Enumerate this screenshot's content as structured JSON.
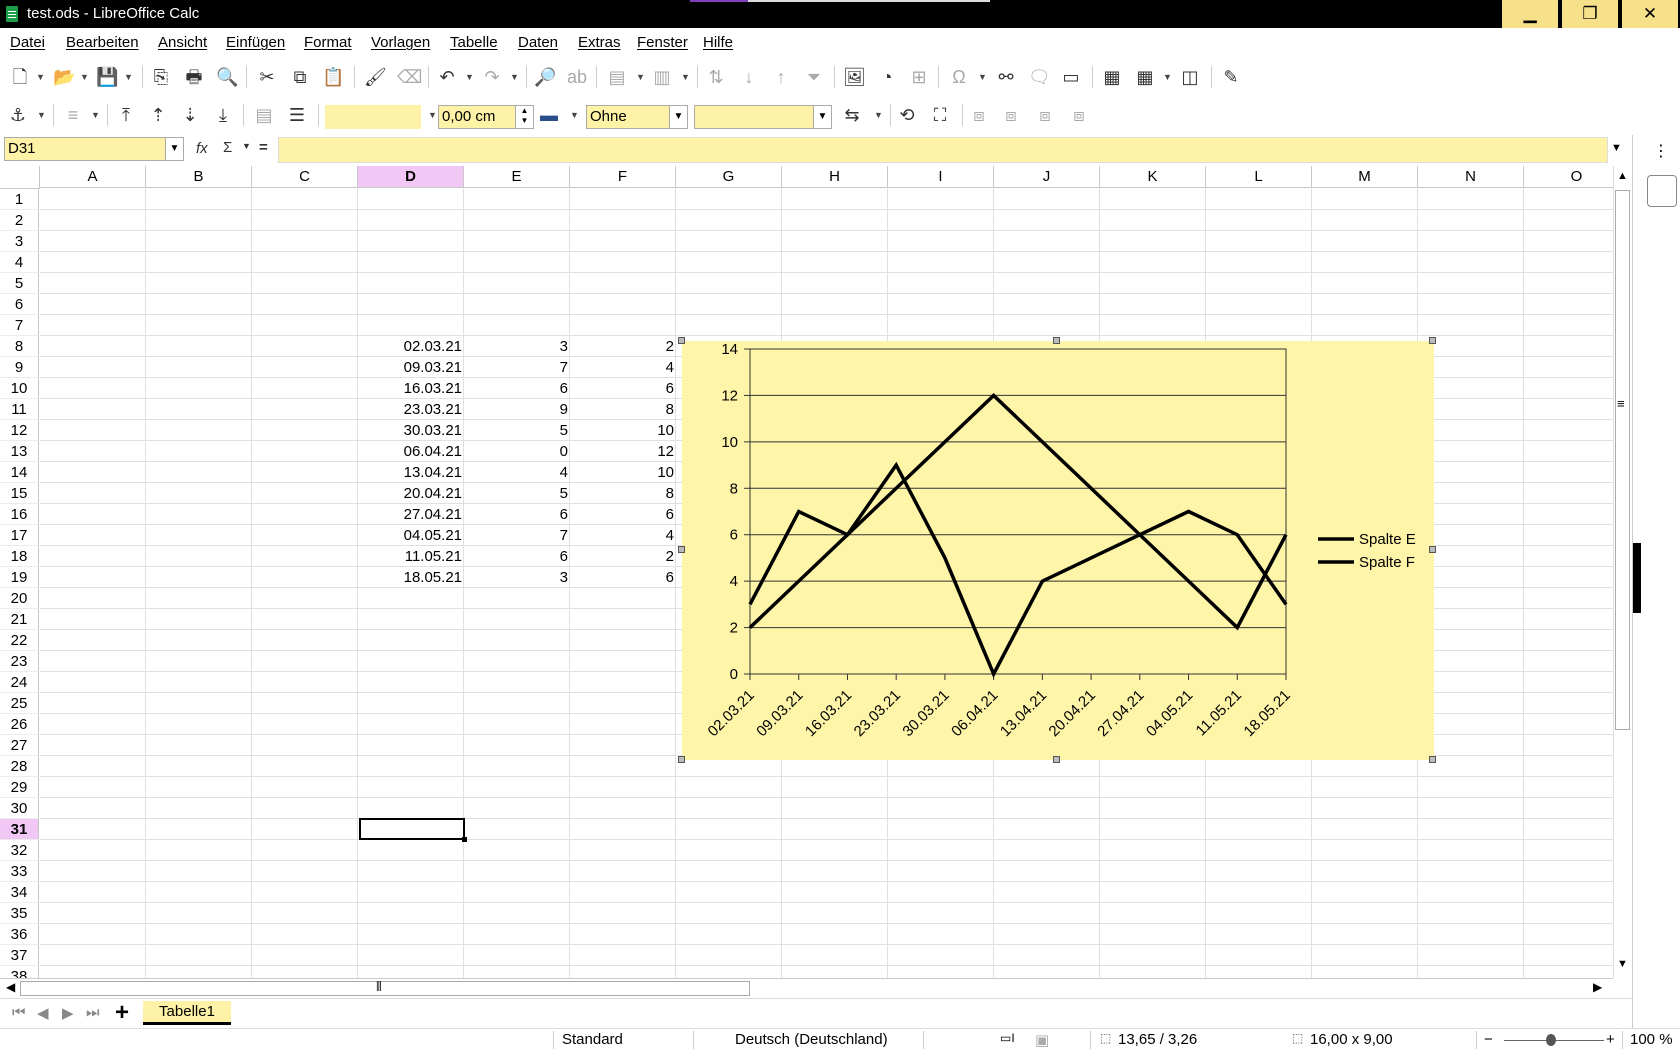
{
  "window": {
    "title": "test.ods - LibreOffice Calc",
    "minimize": "▁",
    "maximize": "❐",
    "close": "✕"
  },
  "menu": [
    "Datei",
    "Bearbeiten",
    "Ansicht",
    "Einfügen",
    "Format",
    "Vorlagen",
    "Tabelle",
    "Daten",
    "Extras",
    "Fenster",
    "Hilfe"
  ],
  "toolbar2": {
    "line_width": "0,00 cm",
    "line_style": "Ohne",
    "area_style": ""
  },
  "formula": {
    "name_box": "D31",
    "fx": "fx",
    "sigma": "Σ",
    "equals": "=",
    "content": ""
  },
  "sheet": {
    "columns": [
      "A",
      "B",
      "C",
      "D",
      "E",
      "F",
      "G",
      "H",
      "I",
      "J",
      "K",
      "L",
      "M",
      "N",
      "O"
    ],
    "active_column": "D",
    "rows": [
      "1",
      "2",
      "3",
      "4",
      "5",
      "6",
      "7",
      "8",
      "9",
      "10",
      "11",
      "12",
      "13",
      "14",
      "15",
      "16",
      "17",
      "18",
      "19",
      "20",
      "21",
      "22",
      "23",
      "24",
      "25",
      "26",
      "27",
      "28",
      "29",
      "30",
      "31",
      "32",
      "33",
      "34",
      "35",
      "36",
      "37",
      "38"
    ],
    "active_row": "31",
    "data": [
      {
        "row": "8",
        "D": "02.03.21",
        "E": "3",
        "F": "2"
      },
      {
        "row": "9",
        "D": "09.03.21",
        "E": "7",
        "F": "4"
      },
      {
        "row": "10",
        "D": "16.03.21",
        "E": "6",
        "F": "6"
      },
      {
        "row": "11",
        "D": "23.03.21",
        "E": "9",
        "F": "8"
      },
      {
        "row": "12",
        "D": "30.03.21",
        "E": "5",
        "F": "10"
      },
      {
        "row": "13",
        "D": "06.04.21",
        "E": "0",
        "F": "12"
      },
      {
        "row": "14",
        "D": "13.04.21",
        "E": "4",
        "F": "10"
      },
      {
        "row": "15",
        "D": "20.04.21",
        "E": "5",
        "F": "8"
      },
      {
        "row": "16",
        "D": "27.04.21",
        "E": "6",
        "F": "6"
      },
      {
        "row": "17",
        "D": "04.05.21",
        "E": "7",
        "F": "4"
      },
      {
        "row": "18",
        "D": "11.05.21",
        "E": "6",
        "F": "2"
      },
      {
        "row": "19",
        "D": "18.05.21",
        "E": "3",
        "F": "6"
      }
    ]
  },
  "chart_data": {
    "type": "line",
    "categories": [
      "02.03.21",
      "09.03.21",
      "16.03.21",
      "23.03.21",
      "30.03.21",
      "06.04.21",
      "13.04.21",
      "20.04.21",
      "27.04.21",
      "04.05.21",
      "11.05.21",
      "18.05.21"
    ],
    "series": [
      {
        "name": "Spalte E",
        "values": [
          3,
          7,
          6,
          9,
          5,
          0,
          4,
          5,
          6,
          7,
          6,
          3
        ]
      },
      {
        "name": "Spalte F",
        "values": [
          2,
          4,
          6,
          8,
          10,
          12,
          10,
          8,
          6,
          4,
          2,
          6
        ]
      }
    ],
    "ylim": [
      0,
      14
    ],
    "yticks": [
      "0",
      "2",
      "4",
      "6",
      "8",
      "10",
      "12",
      "14"
    ],
    "grid": true,
    "legend": "right",
    "background": "#fef5a9",
    "line_color": "#000000"
  },
  "tabs": {
    "sheet_name": "Tabelle1",
    "add": "+"
  },
  "status": {
    "style": "Standard",
    "language": "Deutsch (Deutschland)",
    "position": "13,65 / 3,26",
    "size": "16,00 x 9,00",
    "zoom": "100 %"
  },
  "colors": {
    "accent_yellow": "#fdf2a6",
    "highlight": "#f1c8f5"
  }
}
